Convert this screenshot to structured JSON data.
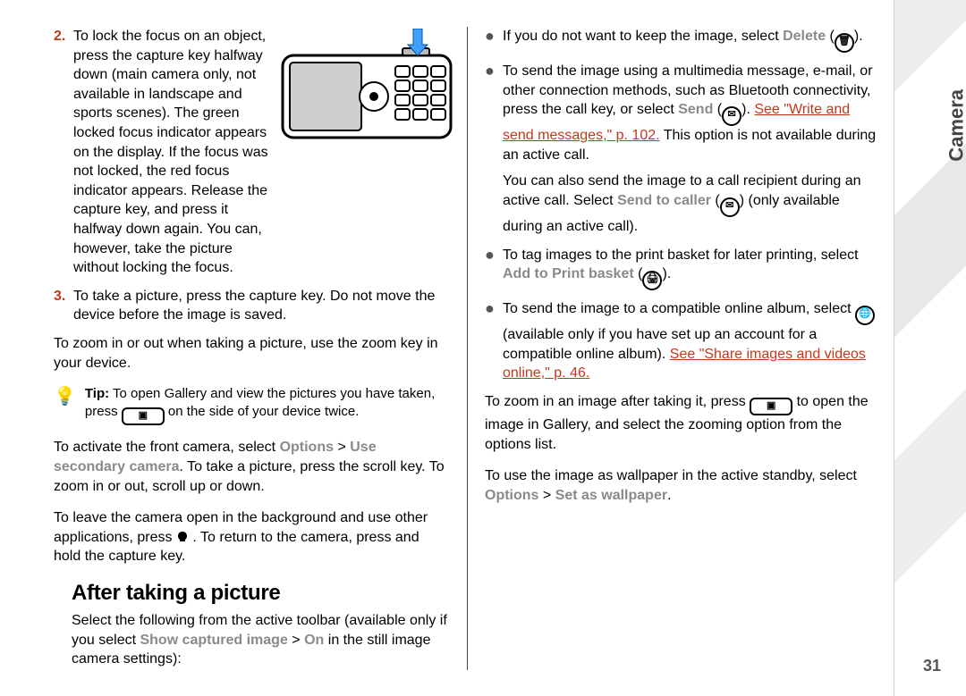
{
  "section_tab": "Camera",
  "page_number": "31",
  "left": {
    "step2_num": "2.",
    "step2": "To lock the focus on an object, press the capture key halfway down (main camera only, not available in landscape and sports scenes). The green locked focus indicator appears on the display. If the focus was not locked, the red focus indicator appears. Release the capture key, and press it halfway down again. You can, however, take the picture without locking the focus.",
    "step3_num": "3.",
    "step3": "To take a picture, press the capture key. Do not move the device before the image is saved.",
    "zoom": "To zoom in or out when taking a picture, use the zoom key in your device.",
    "tip_label": "Tip:",
    "tip_a": " To open Gallery and view the pictures you have taken, press ",
    "tip_b": " on the side of your device twice.",
    "front_a": "To activate the front camera, select ",
    "front_options": "Options",
    "front_gt": " > ",
    "front_use": "Use secondary camera",
    "front_b": ". To take a picture, press the scroll key. To zoom in or out, scroll up or down.",
    "bg_a": "To leave the camera open in the background and use other applications, press ",
    "bg_b": " . To return to the camera, press and hold the capture key."
  },
  "right": {
    "heading": "After taking a picture",
    "intro_a": "Select the following from the active toolbar (available only if you select ",
    "intro_show": "Show captured image",
    "intro_gt": " > ",
    "intro_on": "On",
    "intro_b": " in the still image camera settings):",
    "b1_a": "If you do not want to keep the image, select ",
    "b1_delete": "Delete",
    "b1_b": " (",
    "b1_c": ").",
    "b2_a": "To send the image using a multimedia message, e-mail, or other connection methods, such as Bluetooth connectivity, press the call key, or select ",
    "b2_send": "Send",
    "b2_b": " (",
    "b2_c": "). ",
    "b2_link": "See \"Write and send messages,\" p. 102.",
    "b2_d": " This option is not available during an active call.",
    "b2_e": "You can also send the image to a call recipient during an active call. Select ",
    "b2_sendto": "Send to caller",
    "b2_f": " (",
    "b2_g": ") (only available during an active call).",
    "b3_a": "To tag images to the print basket for later printing, select ",
    "b3_add": "Add to Print basket",
    "b3_b": " (",
    "b3_c": ").",
    "b4_a": "To send the image to a compatible online album, select ",
    "b4_b": " (available only if you have set up an account for a compatible online album). ",
    "b4_link": "See \"Share images and videos online,\" p. 46.",
    "zoom_a": "To zoom in an image after taking it, press ",
    "zoom_b": " to open the image in Gallery, and select the zooming option from the options list.",
    "wall_a": "To use the image as wallpaper in the active standby, select ",
    "wall_opt": "Options",
    "wall_gt": " > ",
    "wall_set": "Set as wallpaper",
    "wall_b": "."
  }
}
